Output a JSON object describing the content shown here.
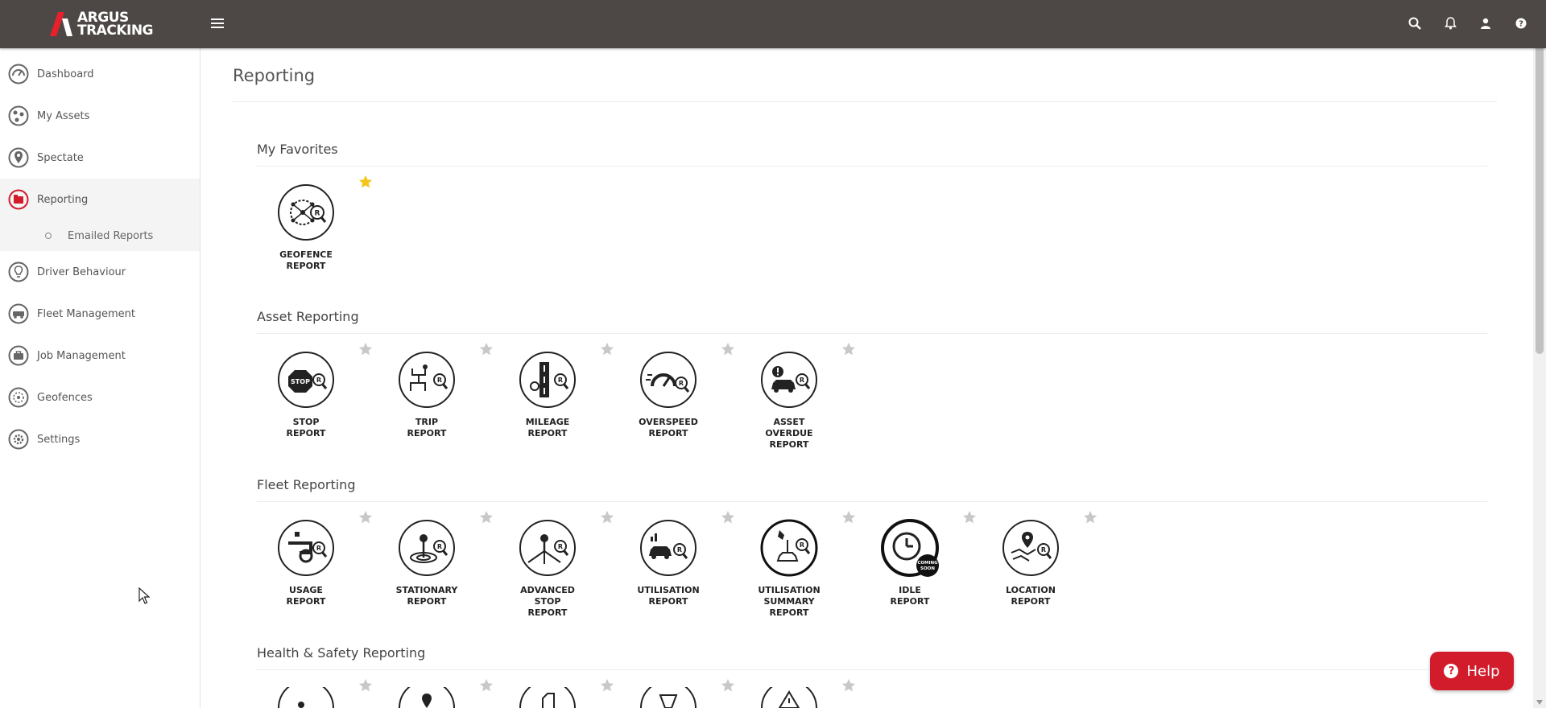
{
  "header": {
    "logo_line1": "ARGUS",
    "logo_line2": "TRACKING",
    "icons": [
      "search-icon",
      "bell-icon",
      "user-icon",
      "help-icon"
    ]
  },
  "sidebar": {
    "items": [
      {
        "label": "Dashboard",
        "icon": "dashboard-icon"
      },
      {
        "label": "My Assets",
        "icon": "assets-icon"
      },
      {
        "label": "Spectate",
        "icon": "location-pin-icon"
      },
      {
        "label": "Reporting",
        "icon": "reporting-icon",
        "active": true
      },
      {
        "label": "Driver Behaviour",
        "icon": "lightbulb-icon"
      },
      {
        "label": "Fleet Management",
        "icon": "fleet-icon"
      },
      {
        "label": "Job Management",
        "icon": "briefcase-icon"
      },
      {
        "label": "Geofences",
        "icon": "geofence-icon"
      },
      {
        "label": "Settings",
        "icon": "gear-icon"
      }
    ],
    "subitem": "Emailed Reports"
  },
  "main": {
    "title": "Reporting",
    "sections": [
      {
        "title": "My Favorites",
        "tiles": [
          "GEOFENCE\nREPORT"
        ]
      },
      {
        "title": "Asset Reporting",
        "tiles": [
          "STOP\nREPORT",
          "TRIP\nREPORT",
          "MILEAGE\nREPORT",
          "OVERSPEED\nREPORT",
          "ASSET\nOVERDUE\nREPORT"
        ]
      },
      {
        "title": "Fleet Reporting",
        "tiles": [
          "USAGE\nREPORT",
          "STATIONARY\nREPORT",
          "ADVANCED\nSTOP\nREPORT",
          "UTILISATION\nREPORT",
          "UTILISATION\nSUMMARY\nREPORT",
          "IDLE\nREPORT",
          "LOCATION\nREPORT"
        ]
      },
      {
        "title": "Health & Safety Reporting",
        "tiles": []
      }
    ],
    "stop_sign_text": "STOP",
    "coming_soon_line1": "COMING",
    "coming_soon_line2": "SOON"
  },
  "help_button": {
    "label": "Help"
  },
  "colors": {
    "topbar": "#4d4745",
    "accent": "#d21c2c",
    "favorite_star": "#f5c518",
    "inactive_star": "#c8c8c8"
  }
}
